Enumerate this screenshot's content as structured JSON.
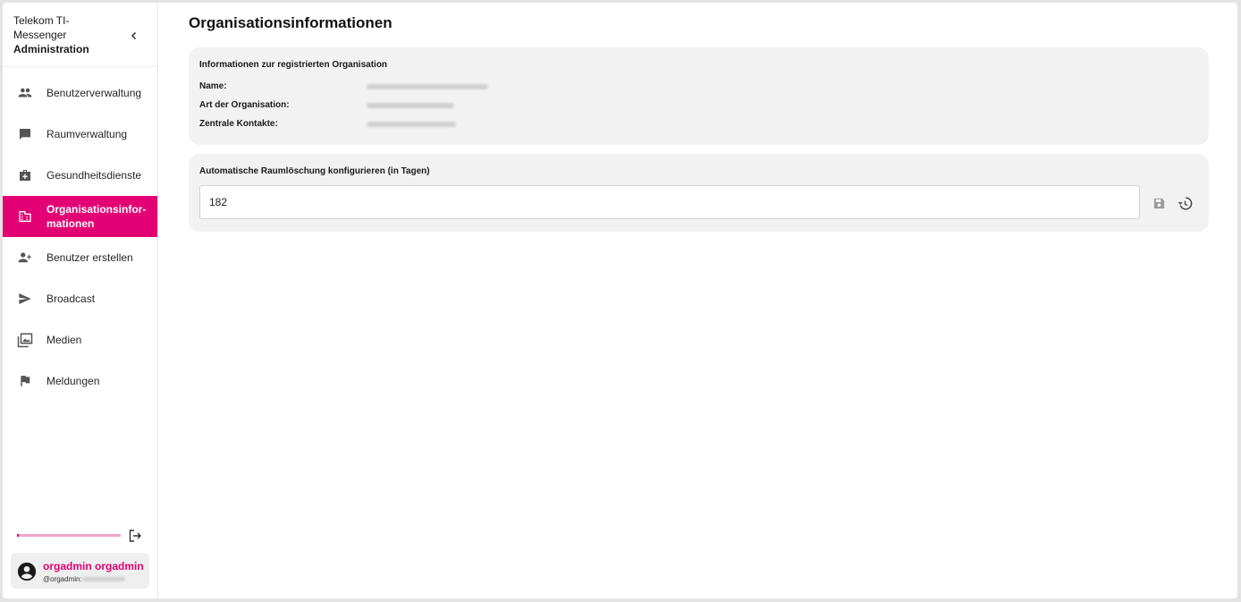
{
  "brand": {
    "line1": "Telekom TI-",
    "line2": "Messenger",
    "line3": "Administration"
  },
  "nav": {
    "items": [
      {
        "label": "Benutzerverwaltung",
        "icon": "people-icon"
      },
      {
        "label": "Raumverwaltung",
        "icon": "chat-icon"
      },
      {
        "label": "Gesundheitsdienste",
        "icon": "medical-bag-icon"
      },
      {
        "label": "Organisationsinfor-mationen",
        "icon": "building-icon",
        "active": true
      },
      {
        "label": "Benutzer erstellen",
        "icon": "person-add-icon"
      },
      {
        "label": "Broadcast",
        "icon": "send-icon"
      },
      {
        "label": "Medien",
        "icon": "photo-library-icon"
      },
      {
        "label": "Meldungen",
        "icon": "flag-icon"
      }
    ]
  },
  "user": {
    "name": "orgadmin orgadmin",
    "id_prefix": "@orgadmin:"
  },
  "page": {
    "title": "Organisationsinformationen"
  },
  "org_card": {
    "title": "Informationen zur registrierten Organisation",
    "name_label": "Name:",
    "type_label": "Art der Organisation:",
    "contacts_label": "Zentrale Kontakte:"
  },
  "deletion_card": {
    "title": "Automatische Raumlöschung konfigurieren (in Tagen)",
    "value": "182"
  },
  "colors": {
    "accent": "#e20074",
    "card_bg": "#f2f2f2"
  }
}
